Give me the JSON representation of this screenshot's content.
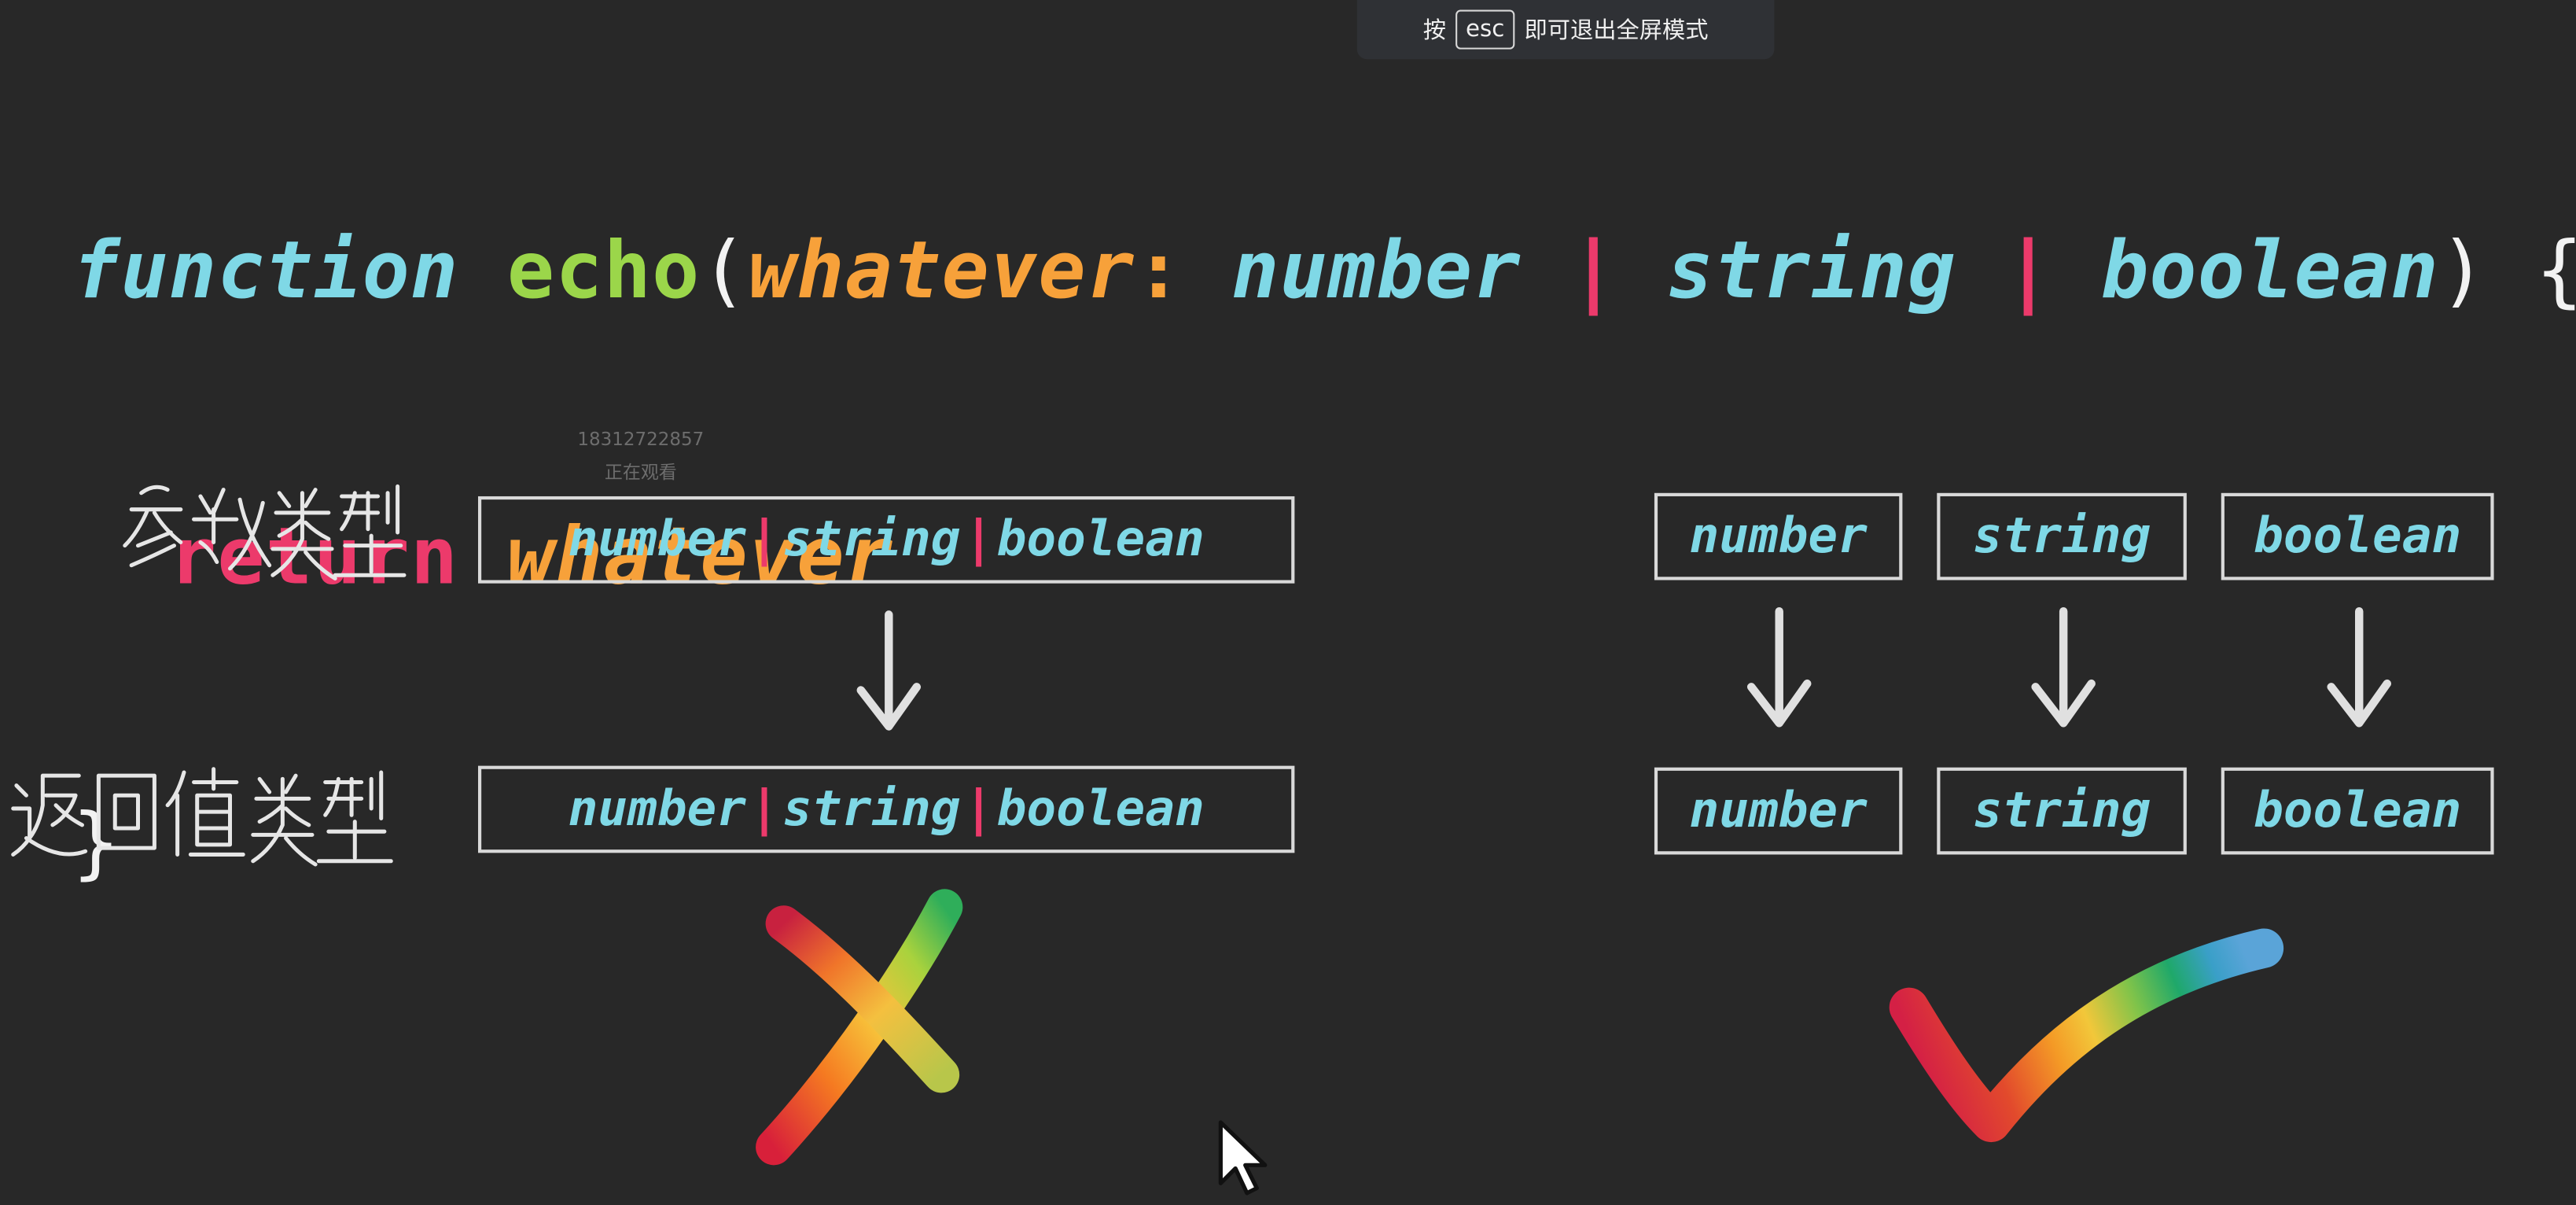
{
  "fullscreen_hint": {
    "prefix": "按",
    "key": "esc",
    "suffix": "即可退出全屏模式"
  },
  "code": {
    "keyword_function": "function",
    "function_name": "echo",
    "open_paren": "(",
    "param_name": "whatever",
    "colon": ":",
    "type_number": "number",
    "pipe": "|",
    "type_string": "string",
    "type_boolean": "boolean",
    "close_paren_brace": ") {",
    "keyword_return": "return",
    "return_value": "whatever",
    "close_brace": "}"
  },
  "watermark": {
    "phone": "18312722857",
    "status": "正在观看"
  },
  "labels": {
    "param_type": "参数类型",
    "return_type": "返回值类型"
  },
  "left_diagram": {
    "param_union": [
      "number",
      "string",
      "boolean"
    ],
    "return_union": [
      "number",
      "string",
      "boolean"
    ],
    "separator": "|"
  },
  "right_diagram": {
    "params": [
      "number",
      "string",
      "boolean"
    ],
    "returns": [
      "number",
      "string",
      "boolean"
    ]
  },
  "icons": {
    "wrong": "rainbow-x-icon",
    "right": "rainbow-check-icon",
    "cursor": "mouse-pointer-icon"
  },
  "colors": {
    "background": "#282828",
    "type_cyan": "#7fd8e6",
    "function_green": "#9bd64a",
    "param_orange": "#f7a13a",
    "keyword_pink": "#ec3a6b",
    "box_border": "#d9d9d9"
  }
}
